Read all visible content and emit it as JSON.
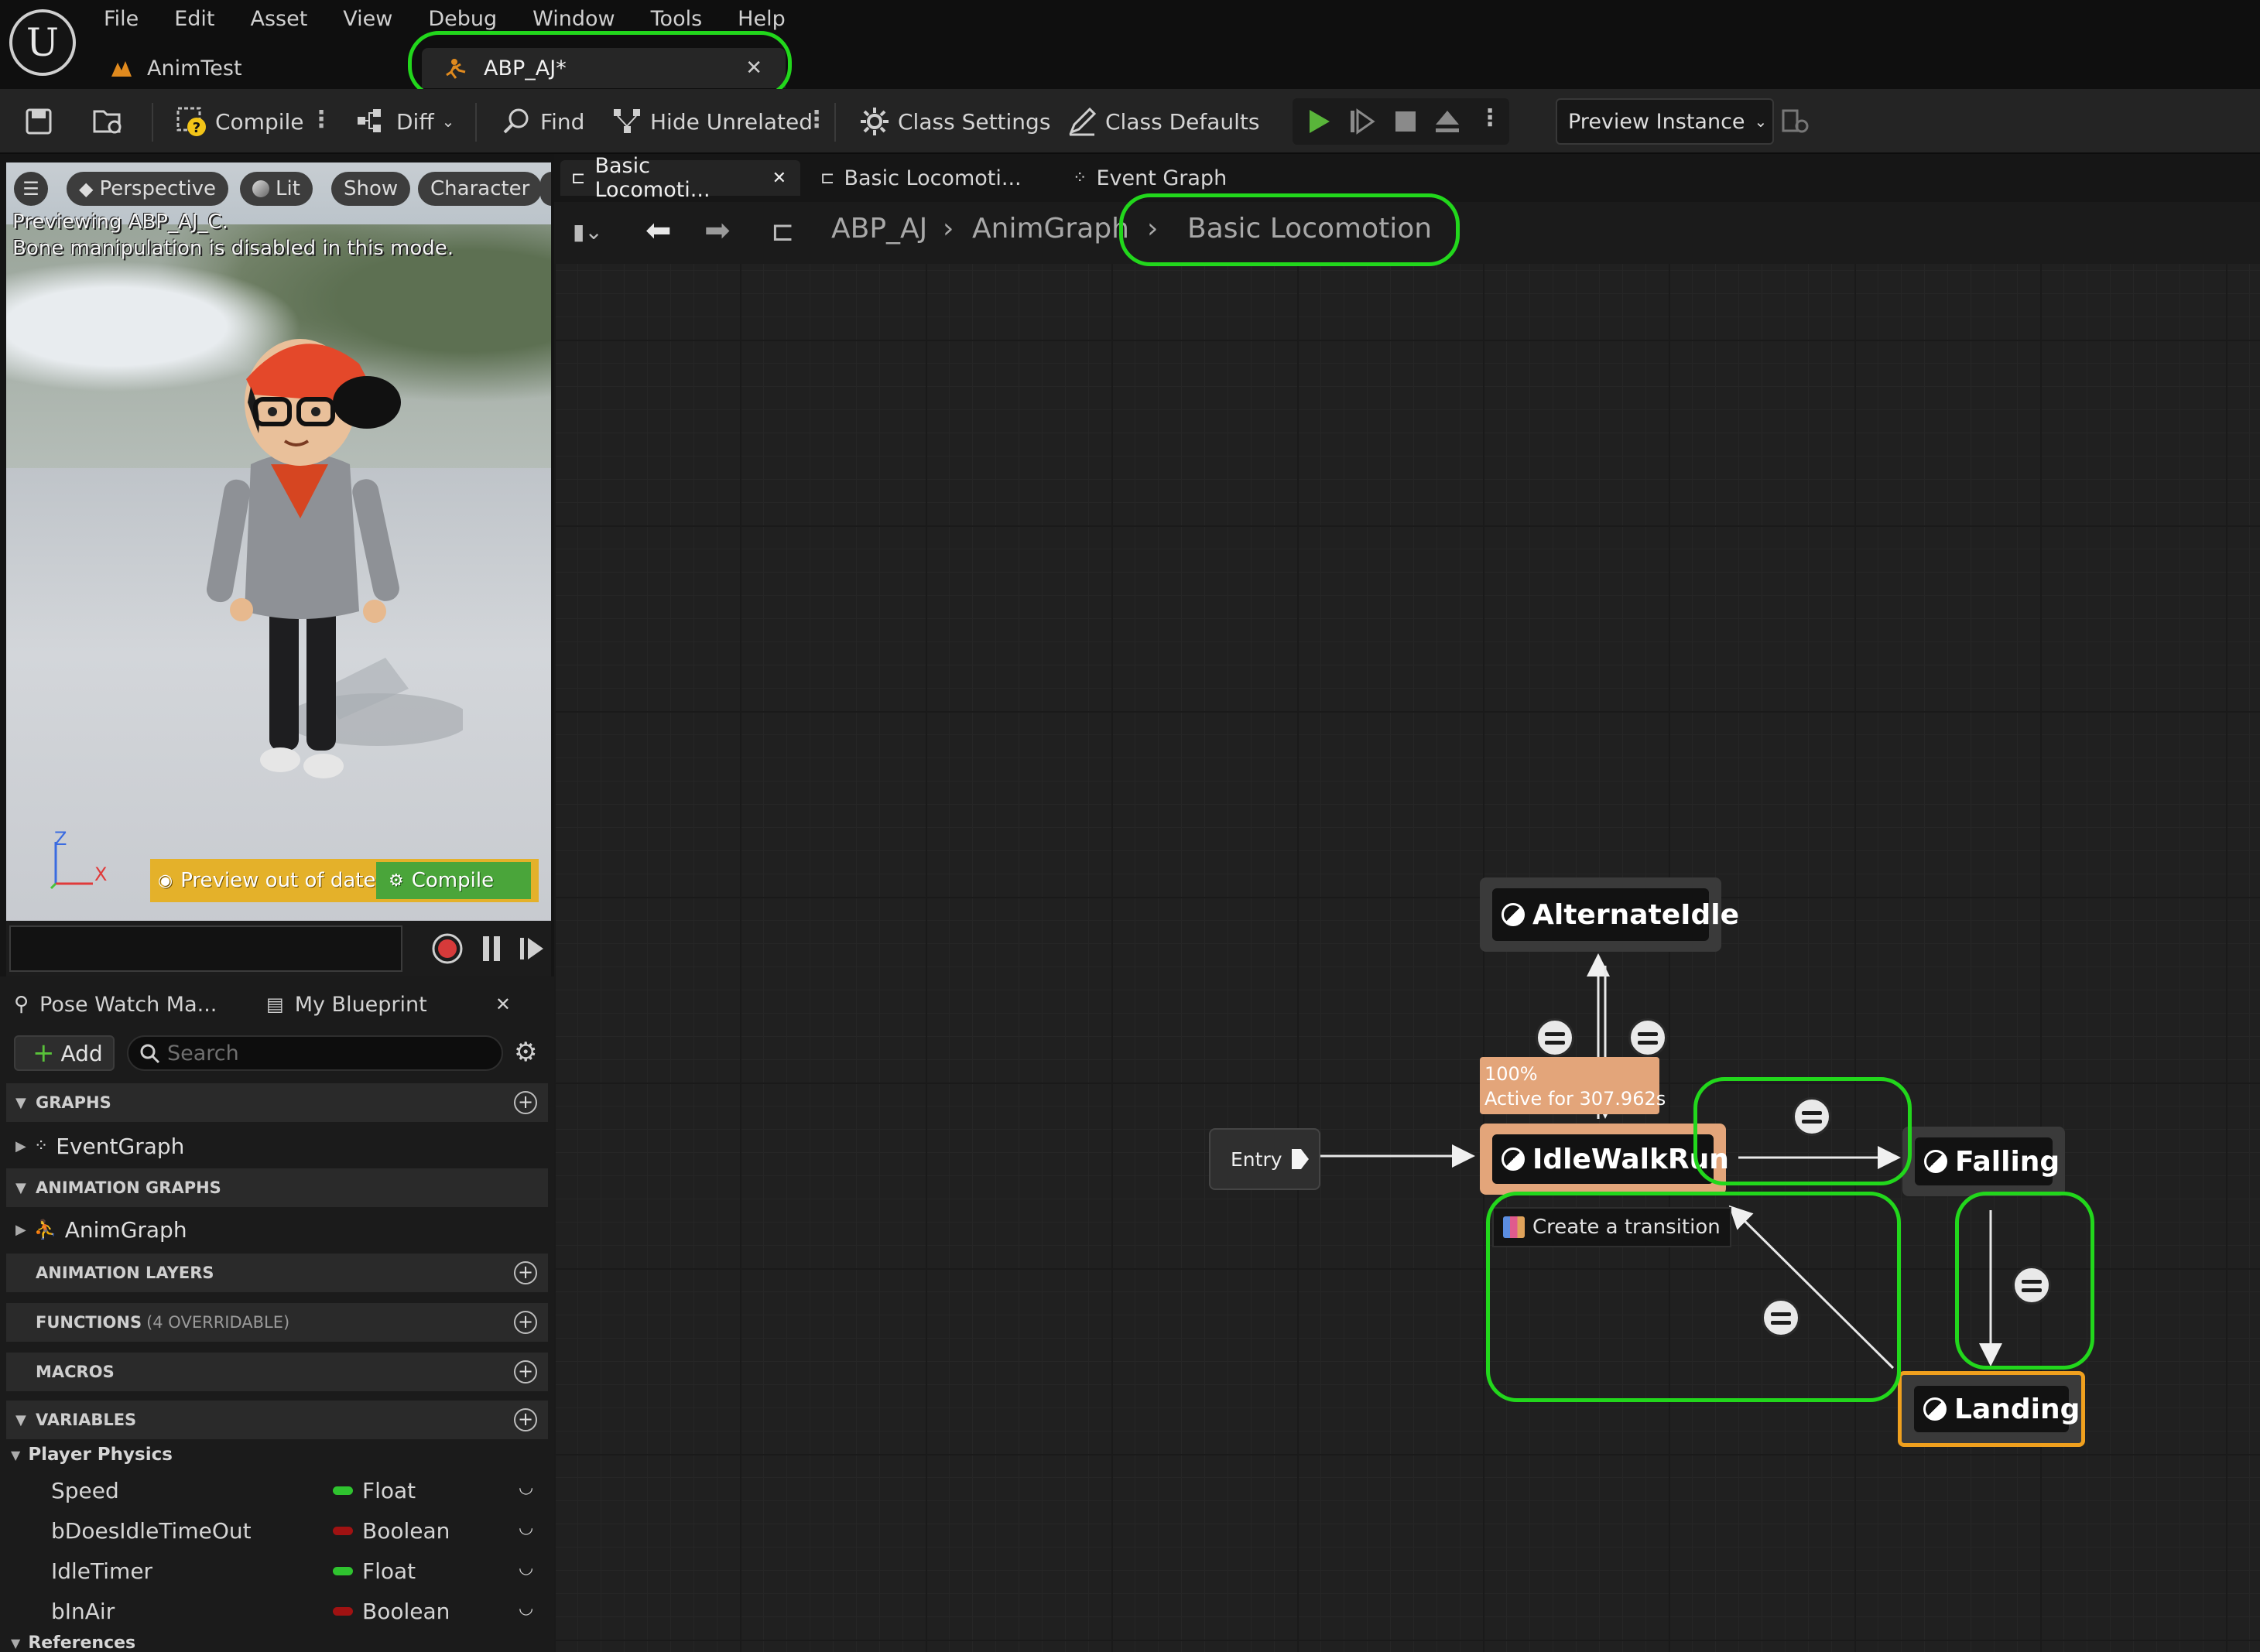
{
  "menu": [
    "File",
    "Edit",
    "Asset",
    "View",
    "Debug",
    "Window",
    "Tools",
    "Help"
  ],
  "doc_tabs": {
    "anim_test": "AnimTest",
    "abp": "ABP_AJ*"
  },
  "toolbar": {
    "compile": "Compile",
    "diff": "Diff",
    "find": "Find",
    "hide_unrelated": "Hide Unrelated",
    "class_settings": "Class Settings",
    "class_defaults": "Class Defaults",
    "preview_instance": "Preview Instance"
  },
  "viewport": {
    "perspective": "Perspective",
    "lit": "Lit",
    "show": "Show",
    "character": "Character",
    "note_line1": "Previewing ABP_AJ_C.",
    "note_line2": "Bone manipulation is disabled in this mode.",
    "preview_out_of_date": "Preview out of date",
    "compile": "Compile",
    "axis_z": "Z",
    "axis_x": "X"
  },
  "panel": {
    "pose_watch_tab": "Pose Watch Ma...",
    "my_blueprint_tab": "My Blueprint",
    "add": "Add",
    "search_placeholder": "Search",
    "sections": {
      "graphs": "GRAPHS",
      "animation_graphs": "ANIMATION GRAPHS",
      "animation_layers": "ANIMATION LAYERS",
      "functions": "FUNCTIONS",
      "functions_sub": "(4 OVERRIDABLE)",
      "macros": "MACROS",
      "variables": "VARIABLES",
      "references": "References"
    },
    "event_graph": "EventGraph",
    "anim_graph": "AnimGraph",
    "player_physics": "Player Physics",
    "variables": [
      {
        "name": "Speed",
        "type": "Float",
        "color": "#2fc32f"
      },
      {
        "name": "bDoesIdleTimeOut",
        "type": "Boolean",
        "color": "#a01212"
      },
      {
        "name": "IdleTimer",
        "type": "Float",
        "color": "#2fc32f"
      },
      {
        "name": "bInAir",
        "type": "Boolean",
        "color": "#a01212"
      }
    ]
  },
  "graph": {
    "tabs": [
      "Basic Locomoti...",
      "Basic Locomoti...",
      "Event Graph"
    ],
    "breadcrumb": [
      "ABP_AJ",
      "AnimGraph",
      "Basic Locomotion"
    ],
    "states": {
      "alternate_idle": "AlternateIdle",
      "idle_walk_run": "IdleWalkRun",
      "falling": "Falling",
      "landing": "Landing"
    },
    "entry": "Entry",
    "active_percent": "100%",
    "active_time": "Active for 307.962s",
    "create_transition": "Create a transition"
  },
  "colors": {
    "highlight": "#22d71c",
    "active_state": "#e3a57a",
    "landing_border": "#f0a01e",
    "play_green": "#59b53a"
  }
}
